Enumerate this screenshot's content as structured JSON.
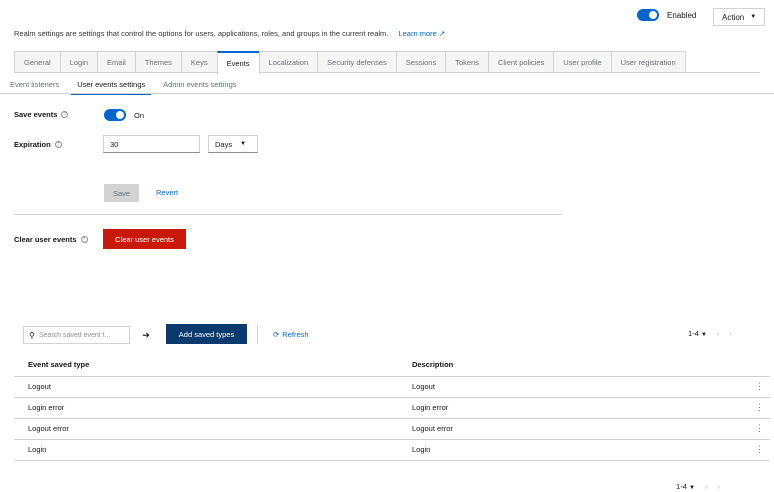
{
  "header": {
    "enabled_label": "Enabled",
    "action_label": "Action",
    "intro_text": "Realm settings are settings that control the options for users, applications, roles, and groups in the current realm.",
    "learn_more": "Learn more"
  },
  "tabs": [
    "General",
    "Login",
    "Email",
    "Themes",
    "Keys",
    "Events",
    "Localization",
    "Security defenses",
    "Sessions",
    "Tokens",
    "Client policies",
    "User profile",
    "User registration"
  ],
  "subtabs": [
    "Event listeners",
    "User events settings",
    "Admin events settings"
  ],
  "form": {
    "save_events_label": "Save events",
    "save_events_value": "On",
    "expiration_label": "Expiration",
    "expiration_value": "30",
    "expiration_unit": "Days",
    "save_button": "Save",
    "revert_button": "Revert",
    "clear_label": "Clear user events",
    "clear_button": "Clear user events"
  },
  "toolbar": {
    "search_placeholder": "Search saved event t...",
    "add_button": "Add saved types",
    "refresh": "Refresh",
    "pagination": "1-4"
  },
  "table": {
    "headers": [
      "Event saved type",
      "Description"
    ],
    "rows": [
      [
        "Logout",
        "Logout"
      ],
      [
        "Login error",
        "Login error"
      ],
      [
        "Logout error",
        "Logout error"
      ],
      [
        "Login",
        "Login"
      ]
    ]
  },
  "footer": {
    "pagination": "1-4"
  },
  "colors": {
    "primary": "#0066cc",
    "danger": "#c9190b",
    "dark_primary": "#0a3a6e"
  }
}
